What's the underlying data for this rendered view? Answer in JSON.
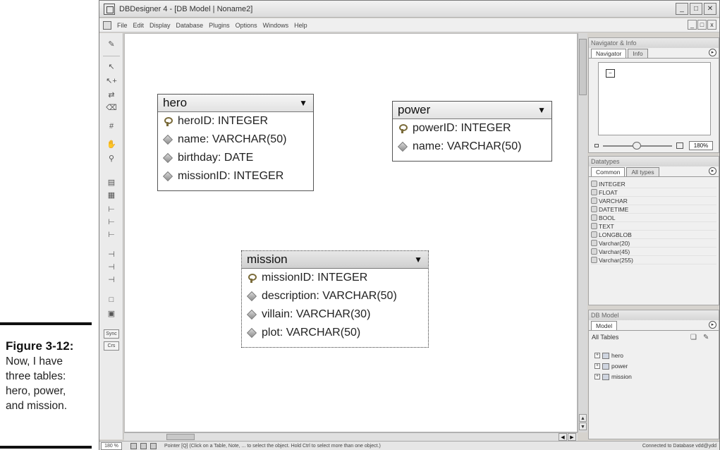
{
  "caption": {
    "figure": "Figure 3-12:",
    "lines": [
      "Now, I have",
      "three tables:",
      "hero, power,",
      "and mission."
    ]
  },
  "window": {
    "title": "DBDesigner 4 - [DB Model | Noname2]",
    "controls": [
      "_",
      "□",
      "✕"
    ]
  },
  "menu": {
    "items": [
      "File",
      "Edit",
      "Display",
      "Database",
      "Plugins",
      "Options",
      "Windows",
      "Help"
    ],
    "mdi_controls": [
      "_",
      "□",
      "x"
    ]
  },
  "toolbar": {
    "sync_label": "Sync",
    "crs_label": "Crs"
  },
  "tables": {
    "hero": {
      "name": "hero",
      "fields": [
        {
          "text": "heroID: INTEGER",
          "key": true
        },
        {
          "text": "name: VARCHAR(50)",
          "key": false
        },
        {
          "text": "birthday: DATE",
          "key": false
        },
        {
          "text": "missionID: INTEGER",
          "key": false
        }
      ]
    },
    "power": {
      "name": "power",
      "fields": [
        {
          "text": "powerID: INTEGER",
          "key": true
        },
        {
          "text": "name: VARCHAR(50)",
          "key": false
        }
      ]
    },
    "mission": {
      "name": "mission",
      "fields": [
        {
          "text": "missionID: INTEGER",
          "key": true
        },
        {
          "text": "description: VARCHAR(50)",
          "key": false
        },
        {
          "text": "villain: VARCHAR(30)",
          "key": false
        },
        {
          "text": "plot: VARCHAR(50)",
          "key": false
        }
      ]
    }
  },
  "navigator": {
    "title": "Navigator & Info",
    "tabs": [
      "Navigator",
      "Info"
    ],
    "zoom": "180%"
  },
  "datatypes": {
    "title": "Datatypes",
    "tabs": [
      "Common",
      "All types"
    ],
    "items": [
      "INTEGER",
      "FLOAT",
      "VARCHAR",
      "DATETIME",
      "BOOL",
      "TEXT",
      "LONGBLOB",
      "Varchar(20)",
      "Varchar(45)",
      "Varchar(255)"
    ]
  },
  "dbmodel": {
    "title": "DB Model",
    "tab": "Model",
    "all_tables_label": "All Tables",
    "tree": [
      "hero",
      "power",
      "mission"
    ]
  },
  "status": {
    "zoom": "180 %",
    "hint": "Pointer [Q] (Click on a Table, Note, ... to select the object. Hold Ctrl to select more than one object.)",
    "connection": "Connected to Database vdd@ydd"
  }
}
